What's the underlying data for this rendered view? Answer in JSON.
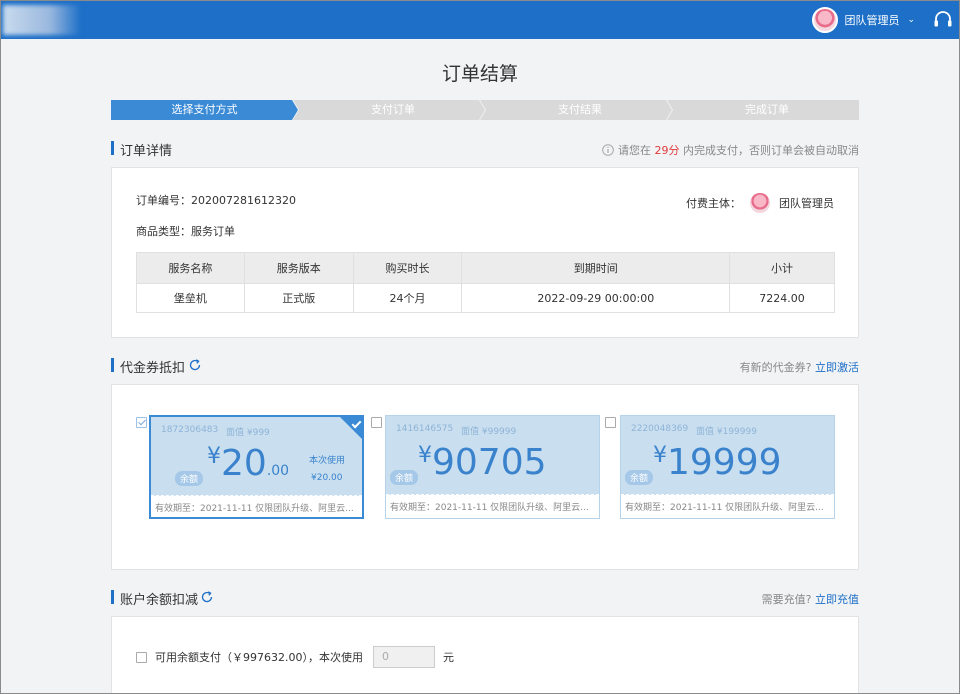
{
  "header": {
    "user_name": "团队管理员",
    "chevron": "⌄"
  },
  "page_title": "订单结算",
  "steps": [
    {
      "label": "选择支付方式",
      "active": true
    },
    {
      "label": "支付订单",
      "active": false
    },
    {
      "label": "支付结果",
      "active": false
    },
    {
      "label": "完成订单",
      "active": false
    }
  ],
  "order_detail": {
    "section_title": "订单详情",
    "notice_prefix": "请您在",
    "notice_minutes": "29分",
    "notice_suffix": "内完成支付，否则订单会被自动取消",
    "order_no": "订单编号：202007281612320",
    "product_type": "商品类型：服务订单",
    "payer_label": "付费主体：",
    "payer_name": "团队管理员",
    "table": {
      "headers": [
        "服务名称",
        "服务版本",
        "购买时长",
        "到期时间",
        "小计"
      ],
      "rows": [
        [
          "堡垒机",
          "正式版",
          "24个月",
          "2022-09-29 00:00:00",
          "7224.00"
        ]
      ]
    }
  },
  "coupons": {
    "section_title": "代金券抵扣",
    "right_prefix": "有新的代金券?",
    "right_link": "立即激活",
    "items": [
      {
        "id": "1872306483",
        "face": "面值 ¥999",
        "badge": "余额",
        "currency": "¥",
        "amount": "20",
        "decimal": ".00",
        "used_label": "本次使用",
        "used_value": "¥20.00",
        "footer": "有效期至：2021-11-11 仅限团队升级、阿里云...",
        "selected": true
      },
      {
        "id": "1416146575",
        "face": "面值 ¥99999",
        "badge": "余额",
        "currency": "¥",
        "amount": "90705",
        "decimal": "",
        "used_label": "",
        "used_value": "",
        "footer": "有效期至：2021-11-11 仅限团队升级、阿里云...",
        "selected": false
      },
      {
        "id": "2220048369",
        "face": "面值 ¥199999",
        "badge": "余额",
        "currency": "¥",
        "amount": "19999",
        "decimal": "",
        "used_label": "",
        "used_value": "",
        "footer": "有效期至：2021-11-11 仅限团队升级、阿里云...",
        "selected": false
      }
    ]
  },
  "balance": {
    "section_title": "账户余额扣减",
    "right_prefix": "需要充值?",
    "right_link": "立即充值",
    "label": "可用余额支付（￥997632.00），本次使用",
    "input_value": "0",
    "unit": "元"
  },
  "colors": {
    "primary": "#1d6fc7",
    "step_active": "#3a8ad6",
    "step_inactive": "#d9d9d9",
    "coupon_bg": "#c9dff0",
    "notice_red": "#e03b3b"
  }
}
